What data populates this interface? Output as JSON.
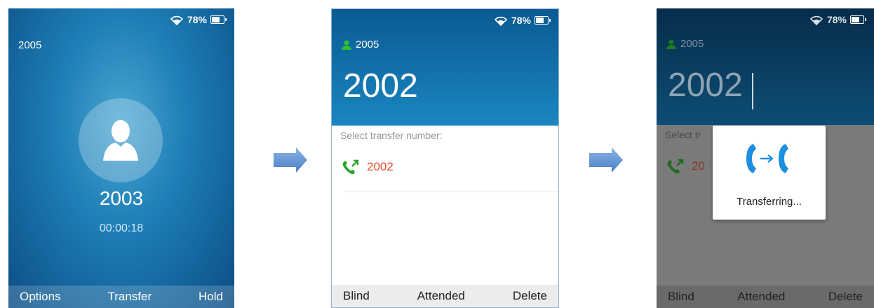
{
  "status": {
    "battery_text": "78%"
  },
  "screen1": {
    "account": "2005",
    "number": "2003",
    "timer": "00:00:18",
    "softkeys": [
      "Options",
      "Transfer",
      "Hold"
    ]
  },
  "screen2": {
    "account": "2005",
    "dial_number": "2002",
    "select_label": "Select transfer number:",
    "contact": "2002",
    "softkeys": [
      "Blind",
      "Attended",
      "Delete"
    ]
  },
  "screen3": {
    "account": "2005",
    "dial_number": "2002",
    "select_label": "Select tr",
    "contact": "20",
    "dialog_message": "Transferring...",
    "softkeys": [
      "Blind",
      "Attended",
      "Delete"
    ]
  },
  "icons": {
    "wifi": "wifi-icon",
    "battery": "battery-icon",
    "person": "person-icon",
    "call_out": "outgoing-call-icon",
    "transfer": "call-transfer-icon",
    "arrow": "right-arrow-icon"
  },
  "colors": {
    "contact_red": "#e84a2a",
    "account_green": "#2fbf2f",
    "call_green": "#2aa52a",
    "transfer_blue": "#1d8fe0",
    "arrow_blue": "#5b8ed0"
  }
}
